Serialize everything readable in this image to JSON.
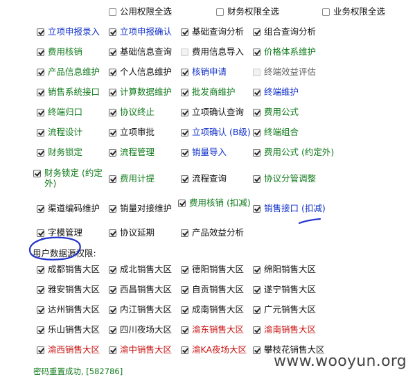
{
  "select_all": [
    {
      "label": "公用权限全选",
      "checked": false
    },
    {
      "label": "财务权限全选",
      "checked": false
    },
    {
      "label": "业务权限全选",
      "checked": false
    }
  ],
  "permissions": [
    [
      {
        "label": "立项申报录入",
        "checked": true,
        "color": "blue"
      },
      {
        "label": "立项申报确认",
        "checked": true,
        "color": "blue"
      },
      {
        "label": "基础查询分析",
        "checked": true,
        "color": "black"
      },
      {
        "label": "组合查询分析",
        "checked": true,
        "color": "black"
      }
    ],
    [
      {
        "label": "费用核销",
        "checked": true,
        "color": "green"
      },
      {
        "label": "基础信息查询",
        "checked": true,
        "color": "black"
      },
      {
        "label": "费用信息导入",
        "checked": false,
        "color": "black"
      },
      {
        "label": "价格体系维护",
        "checked": true,
        "color": "green"
      }
    ],
    [
      {
        "label": "产品信息维护",
        "checked": true,
        "color": "green"
      },
      {
        "label": "个人信息维护",
        "checked": true,
        "color": "black"
      },
      {
        "label": "核销申请",
        "checked": true,
        "color": "blue"
      },
      {
        "label": "终端效益评估",
        "checked": false,
        "color": "gray"
      }
    ],
    [
      {
        "label": "销售系统接口",
        "checked": true,
        "color": "green"
      },
      {
        "label": "计算数据维护",
        "checked": true,
        "color": "green"
      },
      {
        "label": "批发商维护",
        "checked": true,
        "color": "green"
      },
      {
        "label": "终端维护",
        "checked": true,
        "color": "blue"
      }
    ],
    [
      {
        "label": "终端归口",
        "checked": true,
        "color": "green"
      },
      {
        "label": "协议终止",
        "checked": true,
        "color": "green"
      },
      {
        "label": "立项确认查询",
        "checked": true,
        "color": "black"
      },
      {
        "label": "费用公式",
        "checked": true,
        "color": "green"
      }
    ],
    [
      {
        "label": "流程设计",
        "checked": true,
        "color": "green"
      },
      {
        "label": "立项审批",
        "checked": true,
        "color": "black"
      },
      {
        "label": "立项确认 (B级)",
        "checked": true,
        "color": "blue"
      },
      {
        "label": "终端组合",
        "checked": true,
        "color": "green"
      }
    ],
    [
      {
        "label": "财务锁定",
        "checked": true,
        "color": "green"
      },
      {
        "label": "流程管理",
        "checked": true,
        "color": "green"
      },
      {
        "label": "销量导入",
        "checked": true,
        "color": "blue"
      },
      {
        "label": "费用公式 (约定外)",
        "checked": true,
        "color": "green"
      }
    ],
    [
      {
        "label": "财务锁定 (约定外)",
        "checked": true,
        "color": "green",
        "wrap": true
      },
      {
        "label": "费用计提",
        "checked": true,
        "color": "green"
      },
      {
        "label": "流程查询",
        "checked": true,
        "color": "black"
      },
      {
        "label": "协议分管调整",
        "checked": true,
        "color": "green"
      }
    ],
    [
      {
        "label": "渠道编码维护",
        "checked": true,
        "color": "black"
      },
      {
        "label": "销量对接维护",
        "checked": true,
        "color": "black"
      },
      {
        "label": "费用核销 (扣减)",
        "checked": true,
        "color": "green",
        "wrap": true
      },
      {
        "label": "销售接口 (扣减)",
        "checked": true,
        "color": "blue"
      }
    ],
    [
      {
        "label": "字模管理",
        "checked": true,
        "color": "black"
      },
      {
        "label": "协议延期",
        "checked": true,
        "color": "black"
      },
      {
        "label": "产品效益分析",
        "checked": true,
        "color": "black"
      }
    ]
  ],
  "user_data_section": {
    "label": "用户数据源权限:"
  },
  "regions": [
    [
      {
        "label": "成都销售大区",
        "checked": true,
        "color": "black"
      },
      {
        "label": "成北销售大区",
        "checked": true,
        "color": "black"
      },
      {
        "label": "德阳销售大区",
        "checked": true,
        "color": "black"
      },
      {
        "label": "绵阳销售大区",
        "checked": true,
        "color": "black"
      }
    ],
    [
      {
        "label": "雅安销售大区",
        "checked": true,
        "color": "black"
      },
      {
        "label": "西昌销售大区",
        "checked": true,
        "color": "black"
      },
      {
        "label": "自贡销售大区",
        "checked": true,
        "color": "black"
      },
      {
        "label": "遂宁销售大区",
        "checked": true,
        "color": "black"
      }
    ],
    [
      {
        "label": "达州销售大区",
        "checked": true,
        "color": "black"
      },
      {
        "label": "内江销售大区",
        "checked": true,
        "color": "black"
      },
      {
        "label": "成南销售大区",
        "checked": true,
        "color": "black"
      },
      {
        "label": "广元销售大区",
        "checked": true,
        "color": "black"
      }
    ],
    [
      {
        "label": "乐山销售大区",
        "checked": true,
        "color": "black"
      },
      {
        "label": "四川夜场大区",
        "checked": true,
        "color": "black"
      },
      {
        "label": "渝东销售大区",
        "checked": true,
        "color": "red"
      },
      {
        "label": "渝南销售大区",
        "checked": true,
        "color": "red"
      }
    ],
    [
      {
        "label": "渝西销售大区",
        "checked": true,
        "color": "red"
      },
      {
        "label": "渝中销售大区",
        "checked": true,
        "color": "red"
      },
      {
        "label": "渝KA夜场大区",
        "checked": true,
        "color": "red"
      },
      {
        "label": "攀枝花销售大区",
        "checked": true,
        "color": "black"
      }
    ]
  ],
  "status_message": "密码重置成功, [582786]",
  "watermark": "www.wooyun.org",
  "colors": {
    "blue": "#1030c8",
    "green": "#0f7a1a",
    "red": "#c81010",
    "annotation": "#2233cc"
  }
}
